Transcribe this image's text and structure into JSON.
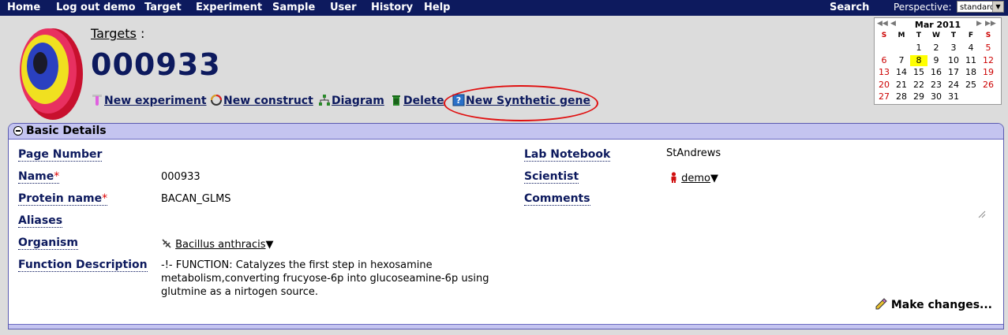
{
  "nav": {
    "items": [
      "Home",
      "Log out demo",
      "Target",
      "Experiment",
      "Sample",
      "User",
      "History",
      "Help"
    ],
    "search": "Search",
    "perspective_label": "Perspective:",
    "perspective_value": "standard"
  },
  "header": {
    "breadcrumb": "Targets",
    "breadcrumb_sep": ":",
    "title": "000933"
  },
  "actions": {
    "new_experiment": "New experiment",
    "new_construct": "New construct",
    "diagram": "Diagram",
    "delete": "Delete",
    "new_synthetic_gene": "New Synthetic gene"
  },
  "calendar": {
    "month": "Mar 2011",
    "dow": [
      "S",
      "M",
      "T",
      "W",
      "T",
      "F",
      "S"
    ],
    "weeks": [
      [
        "",
        "",
        "1",
        "2",
        "3",
        "4",
        "5"
      ],
      [
        "6",
        "7",
        "8",
        "9",
        "10",
        "11",
        "12"
      ],
      [
        "13",
        "14",
        "15",
        "16",
        "17",
        "18",
        "19"
      ],
      [
        "20",
        "21",
        "22",
        "23",
        "24",
        "25",
        "26"
      ],
      [
        "27",
        "28",
        "29",
        "30",
        "31",
        "",
        ""
      ]
    ],
    "today": "8",
    "colors": {
      "weekend": "#cc0000",
      "today": "#ffff00"
    }
  },
  "panel": {
    "title": "Basic Details",
    "make_changes": "Make changes...",
    "fields": {
      "page_number": {
        "label": "Page Number",
        "value": ""
      },
      "name": {
        "label": "Name",
        "required": "*",
        "value": "000933"
      },
      "protein_name": {
        "label": "Protein name",
        "required": "*",
        "value": "BACAN_GLMS"
      },
      "aliases": {
        "label": "Aliases",
        "value": ""
      },
      "organism": {
        "label": "Organism",
        "value": "Bacillus anthracis"
      },
      "function_description": {
        "label": "Function Description",
        "value": "-!- FUNCTION: Catalyzes the first step in hexosamine metabolism,converting frucyose-6p into glucoseamine-6p using glutmine as a nirtogen source."
      },
      "lab_notebook": {
        "label": "Lab Notebook",
        "value": "StAndrews"
      },
      "scientist": {
        "label": "Scientist",
        "value": "demo"
      },
      "comments": {
        "label": "Comments",
        "value": ""
      }
    }
  },
  "colors": {
    "nav_bg": "#0d1a5e",
    "title": "#0d1a5e",
    "panel_header": "#c4c4f0",
    "highlight_ring": "#e01010"
  }
}
